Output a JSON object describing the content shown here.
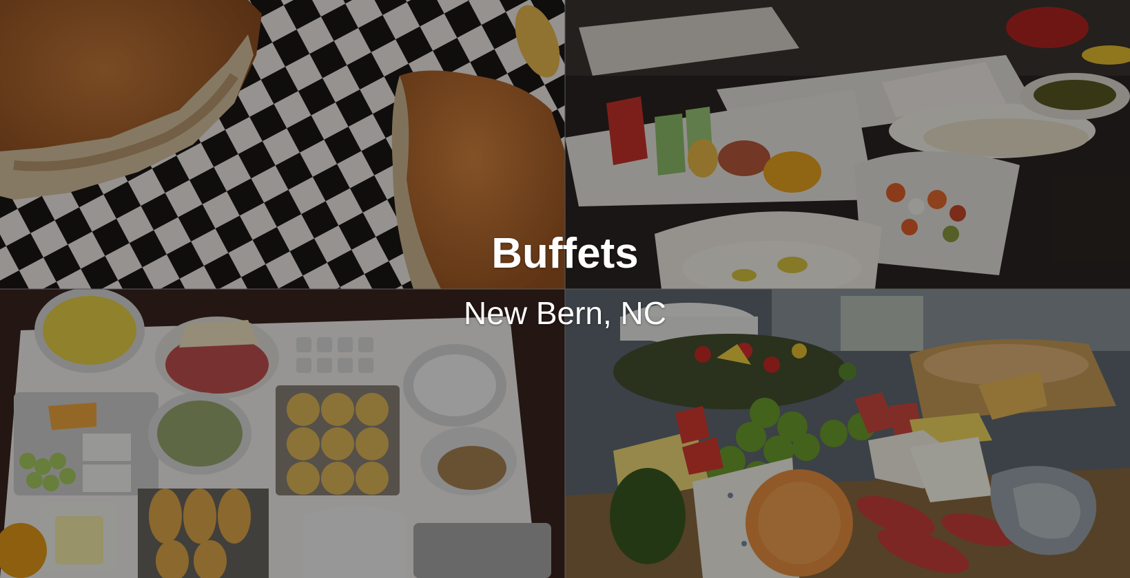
{
  "hero": {
    "title": "Buffets",
    "subtitle": "New Bern, NC"
  },
  "photos": [
    {
      "subject": "sandwiches-on-checkered-paper"
    },
    {
      "subject": "hotel-breakfast-buffet-fruit-platters"
    },
    {
      "subject": "brunch-table-muffins-croissants"
    },
    {
      "subject": "charcuterie-fruit-cheese-board"
    }
  ],
  "overlay_color": "#000000"
}
